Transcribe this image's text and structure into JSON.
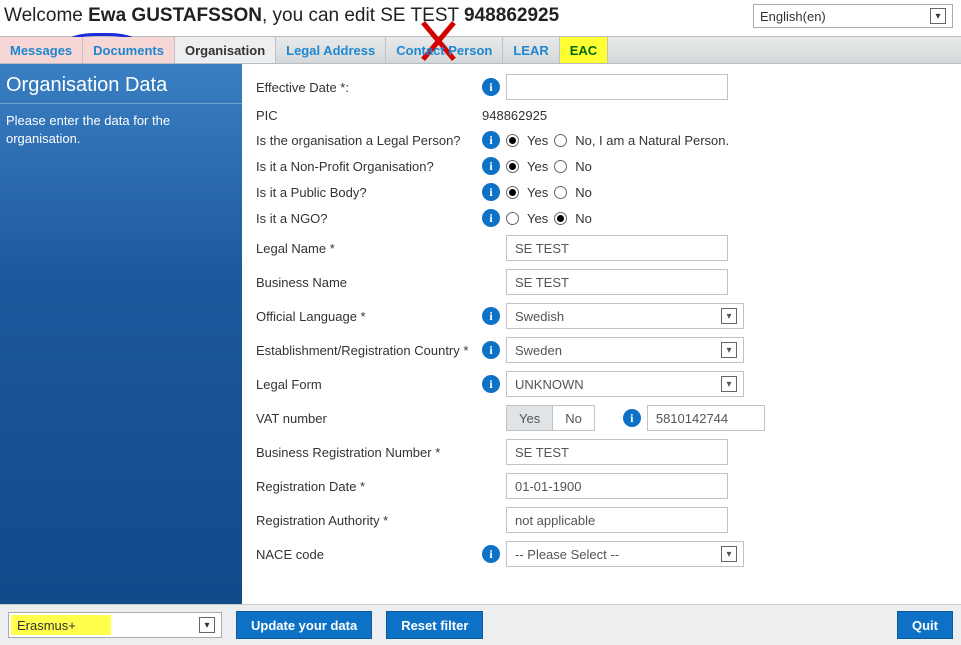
{
  "header": {
    "welcome_prefix": "Welcome ",
    "user_name": "Ewa GUSTAFSSON",
    "welcome_mid": ", you can edit SE TEST ",
    "ref": "948862925"
  },
  "language": {
    "selected": "English(en)"
  },
  "tabs": {
    "messages": "Messages",
    "documents": "Documents",
    "organisation": "Organisation",
    "legal_address": "Legal Address",
    "contact_person": "Contact Person",
    "lear": "LEAR",
    "eac": "EAC"
  },
  "sidebar": {
    "title": "Organisation Data",
    "hint": "Please enter the data for the organisation."
  },
  "form": {
    "effective_date_lbl": "Effective Date *:",
    "effective_date_val": "",
    "pic_lbl": "PIC",
    "pic_val": "948862925",
    "legal_person_lbl": "Is the organisation a Legal Person?",
    "legal_person_yes": "Yes",
    "legal_person_no": "No, I am a Natural Person.",
    "nonprofit_lbl": "Is it a Non-Profit Organisation?",
    "public_body_lbl": "Is it a Public Body?",
    "ngo_lbl": "Is it a NGO?",
    "opt_yes": "Yes",
    "opt_no": "No",
    "legal_name_lbl": "Legal Name *",
    "legal_name_val": "SE TEST",
    "business_name_lbl": "Business Name",
    "business_name_val": "SE TEST",
    "off_lang_lbl": "Official Language *",
    "off_lang_val": "Swedish",
    "est_country_lbl": "Establishment/Registration Country *",
    "est_country_val": "Sweden",
    "legal_form_lbl": "Legal Form",
    "legal_form_val": "UNKNOWN",
    "vat_lbl": "VAT number",
    "vat_yes": "Yes",
    "vat_no": "No",
    "vat_val": "5810142744",
    "brn_lbl": "Business Registration Number *",
    "brn_val": "SE TEST",
    "reg_date_lbl": "Registration Date *",
    "reg_date_val": "01-01-1900",
    "reg_auth_lbl": "Registration Authority *",
    "reg_auth_val": "not applicable",
    "nace_lbl": "NACE code",
    "nace_val": "-- Please Select --"
  },
  "footer": {
    "programme": "Erasmus+",
    "update": "Update your data",
    "reset": "Reset filter",
    "quit": "Quit"
  }
}
